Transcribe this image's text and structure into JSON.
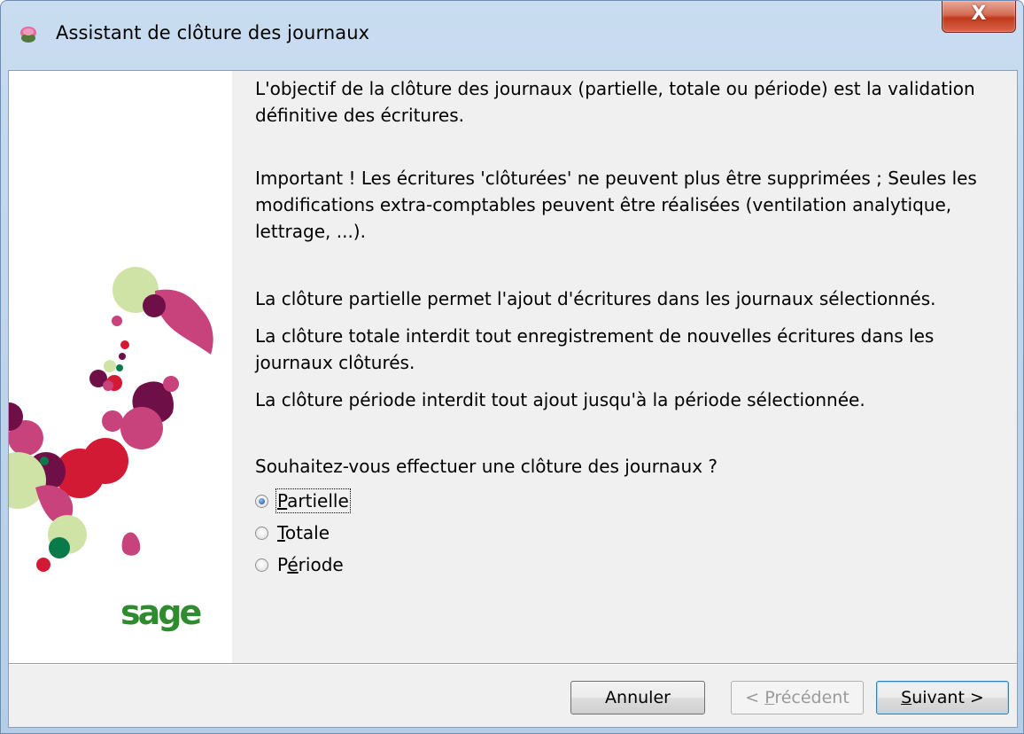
{
  "window": {
    "title": "Assistant de clôture des journaux",
    "close_symbol": "X"
  },
  "content": {
    "intro_line1": "L'objectif de la clôture des journaux (partielle, totale ou période) est la validation",
    "intro_line2": "définitive des écritures.",
    "important_line1": "Important ! Les écritures 'clôturées' ne peuvent plus être supprimées ; Seules les",
    "important_line2": "modifications extra-comptables peuvent être réalisées (ventilation analytique,",
    "important_line3": "lettrage, ...).",
    "partial_desc": "La clôture partielle permet l'ajout d'écritures dans les journaux sélectionnés.",
    "total_desc_line1": "La clôture totale interdit tout enregistrement de nouvelles écritures dans les",
    "total_desc_line2": "journaux clôturés.",
    "period_desc": "La clôture période interdit tout ajout jusqu'à la période sélectionnée.",
    "question": "Souhaitez-vous effectuer une clôture des journaux ?"
  },
  "options": [
    {
      "first": "P",
      "rest": "artielle",
      "checked": true
    },
    {
      "first": "T",
      "rest": "otale",
      "checked": false
    },
    {
      "pre": "P",
      "accel": "é",
      "rest": "riode",
      "checked": false
    }
  ],
  "buttons": {
    "cancel": "Annuler",
    "previous_pre": "< ",
    "previous_accel": "P",
    "previous_rest": "récédent",
    "next_accel": "S",
    "next_rest": "uivant >"
  },
  "logo_text": "sage",
  "colors": {
    "logo": "#2e8b2e",
    "magenta": "#c8437c",
    "crimson": "#d31a35",
    "plum": "#6e0f47",
    "lime": "#cfe3a6",
    "green": "#0b7a4a"
  }
}
